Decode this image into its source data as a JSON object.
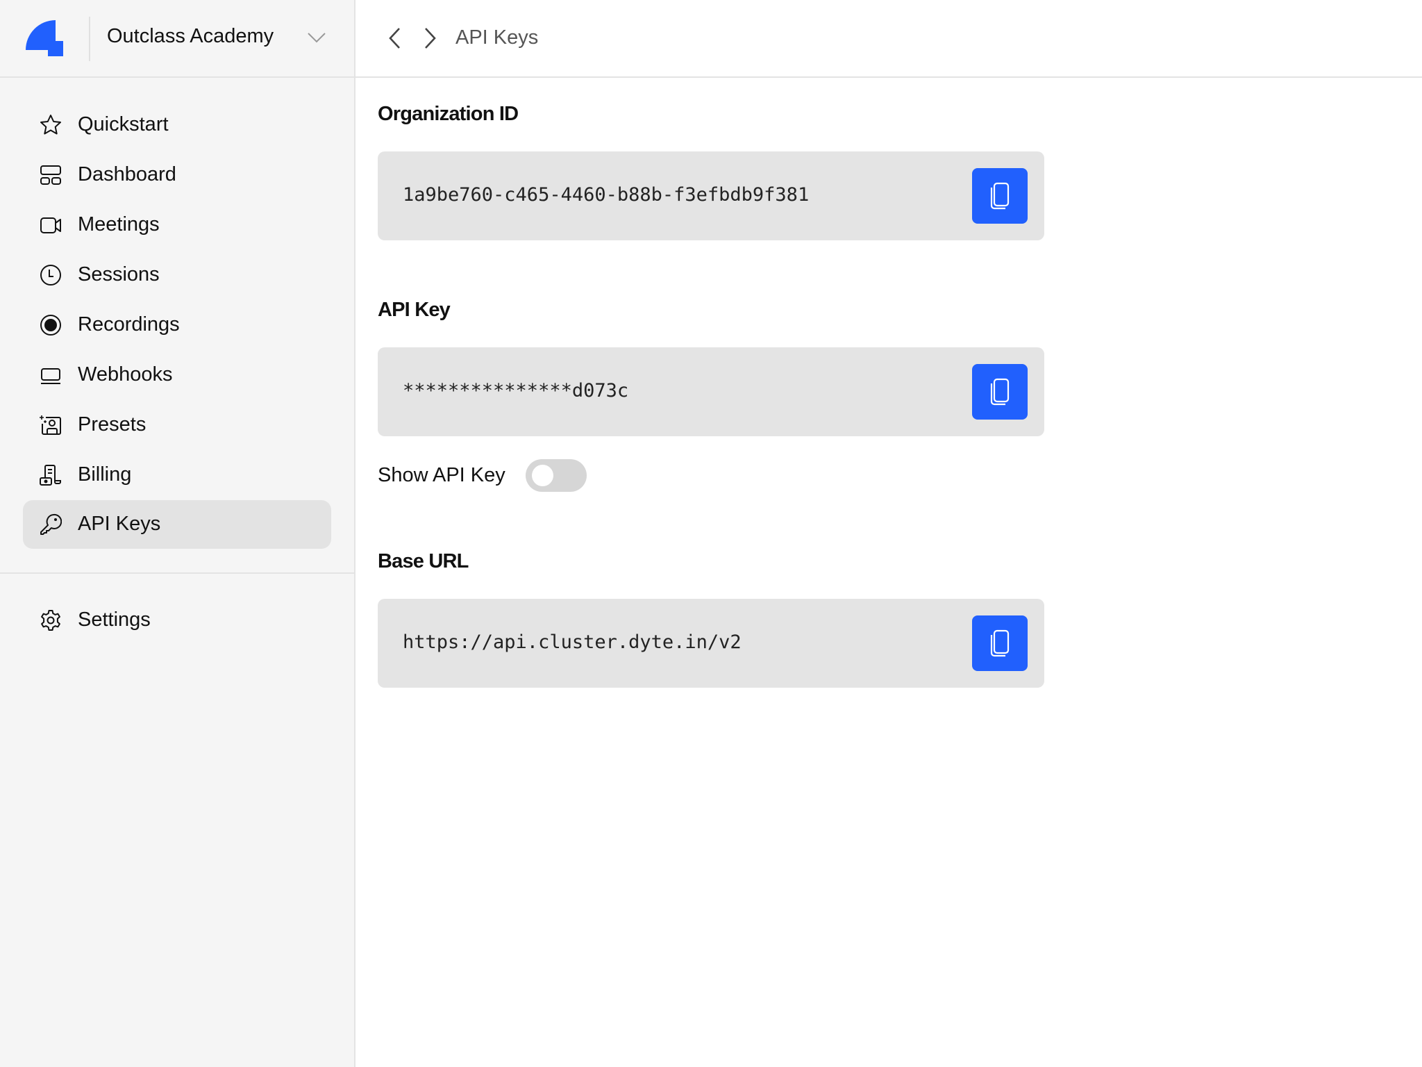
{
  "brand": {
    "accent_color": "#2160fd",
    "logo": "dyte-logo-icon"
  },
  "org_switcher": {
    "name": "Outclass Academy",
    "icon": "chevron-down-icon"
  },
  "sidebar": {
    "items": [
      {
        "label": "Quickstart",
        "icon": "star-icon",
        "active": false
      },
      {
        "label": "Dashboard",
        "icon": "dashboard-icon",
        "active": false
      },
      {
        "label": "Meetings",
        "icon": "video-camera-icon",
        "active": false
      },
      {
        "label": "Sessions",
        "icon": "clock-icon",
        "active": false
      },
      {
        "label": "Recordings",
        "icon": "record-icon",
        "active": false
      },
      {
        "label": "Webhooks",
        "icon": "laptop-icon",
        "active": false
      },
      {
        "label": "Presets",
        "icon": "user-preset-icon",
        "active": false
      },
      {
        "label": "Billing",
        "icon": "billing-receipt-icon",
        "active": false
      },
      {
        "label": "API Keys",
        "icon": "key-icon",
        "active": true
      }
    ],
    "footer_items": [
      {
        "label": "Settings",
        "icon": "gear-icon"
      }
    ]
  },
  "topbar": {
    "back_icon": "chevron-left-icon",
    "forward_icon": "chevron-right-icon",
    "breadcrumb": "API Keys"
  },
  "main": {
    "organization_id": {
      "title": "Organization ID",
      "value": "1a9be760-c465-4460-b88b-f3efbdb9f381",
      "copy_icon": "copy-icon"
    },
    "api_key": {
      "title": "API Key",
      "value": "***************d073c",
      "copy_icon": "copy-icon"
    },
    "show_api_key": {
      "label": "Show API Key",
      "enabled": false
    },
    "base_url": {
      "title": "Base URL",
      "value": "https://api.cluster.dyte.in/v2",
      "copy_icon": "copy-icon"
    }
  }
}
